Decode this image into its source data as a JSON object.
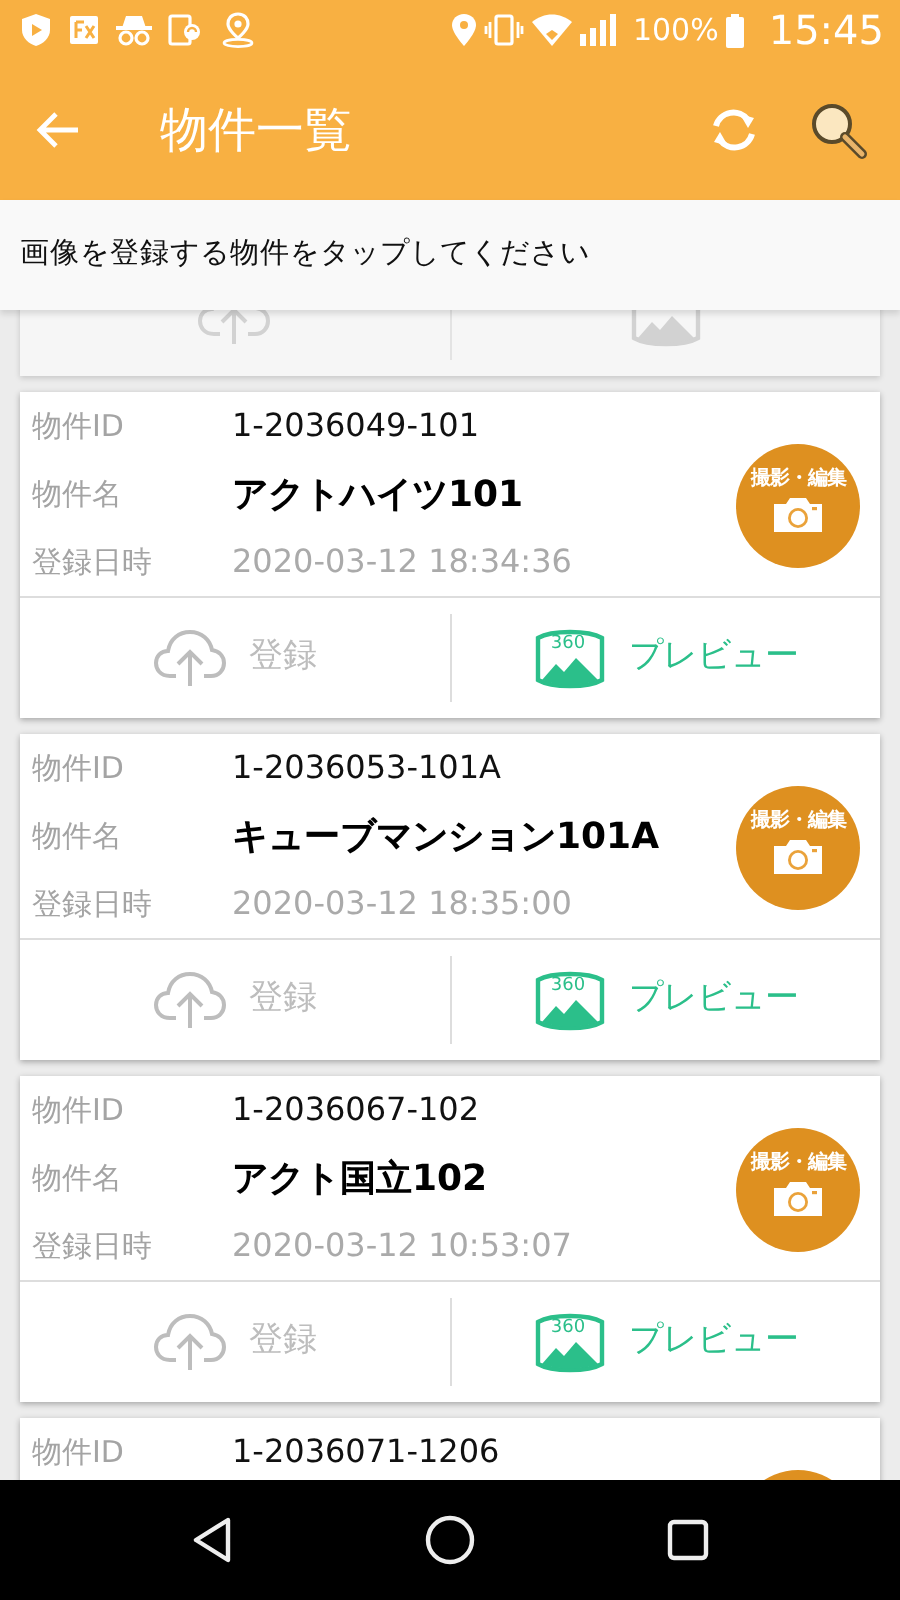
{
  "status_bar": {
    "battery": "100%",
    "time": "15:45"
  },
  "app_bar": {
    "title": "物件一覧"
  },
  "instruction": "画像を登録する物件をタップしてください",
  "properties": [
    {
      "register_enabled": false,
      "preview_enabled": false
    },
    {
      "id_label": "物件ID",
      "id": "1-2036049-101",
      "name_label": "物件名",
      "name": "アクトハイツ101",
      "date_label": "登録日時",
      "date": "2020-03-12 18:34:36",
      "camera_button": true,
      "camera_label": "撮影・編集",
      "register_label": "登録",
      "register_enabled": false,
      "preview_badge": "360",
      "preview_label": "プレビュー",
      "preview_enabled": true
    },
    {
      "id_label": "物件ID",
      "id": "1-2036053-101A",
      "name_label": "物件名",
      "name": "キューブマンション101A",
      "date_label": "登録日時",
      "date": "2020-03-12 18:35:00",
      "camera_button": true,
      "camera_label": "撮影・編集",
      "register_label": "登録",
      "register_enabled": false,
      "preview_badge": "360",
      "preview_label": "プレビュー",
      "preview_enabled": true
    },
    {
      "id_label": "物件ID",
      "id": "1-2036067-102",
      "name_label": "物件名",
      "name": "アクト国立102",
      "date_label": "登録日時",
      "date": "2020-03-12 10:53:07",
      "camera_button": true,
      "camera_label": "撮影・編集",
      "register_label": "登録",
      "register_enabled": false,
      "preview_badge": "360",
      "preview_label": "プレビュー",
      "preview_enabled": true
    },
    {
      "id_label": "物件ID",
      "id": "1-2036071-1206",
      "camera_button": true
    }
  ]
}
